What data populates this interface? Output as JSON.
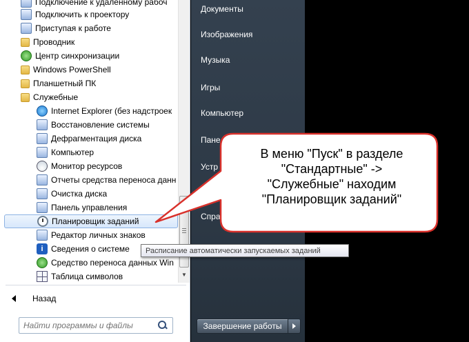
{
  "left_pane": {
    "programs": [
      {
        "label": "Подключение к удаленному рабоч",
        "icon": "remote-desktop-icon",
        "kind": "top",
        "icon_style": "generic"
      },
      {
        "label": "Подключить к проектору",
        "icon": "projector-icon",
        "kind": "top",
        "icon_style": "generic"
      },
      {
        "label": "Приступая к работе",
        "icon": "getting-started-icon",
        "kind": "top",
        "icon_style": "generic"
      },
      {
        "label": "Проводник",
        "icon": "explorer-folder-icon",
        "kind": "top",
        "icon_style": "folder"
      },
      {
        "label": "Центр синхронизации",
        "icon": "sync-center-icon",
        "kind": "top",
        "icon_style": "green"
      },
      {
        "label": "Windows PowerShell",
        "icon": "folder-icon",
        "kind": "top",
        "icon_style": "folder"
      },
      {
        "label": "Планшетный ПК",
        "icon": "folder-icon",
        "kind": "top",
        "icon_style": "folder"
      },
      {
        "label": "Служебные",
        "icon": "folder-icon",
        "kind": "top",
        "icon_style": "folder"
      },
      {
        "label": "Internet Explorer (без надстроек",
        "icon": "internet-explorer-icon",
        "kind": "sub",
        "icon_style": "ie"
      },
      {
        "label": "Восстановление системы",
        "icon": "system-restore-icon",
        "kind": "sub",
        "icon_style": "generic"
      },
      {
        "label": "Дефрагментация диска",
        "icon": "defrag-icon",
        "kind": "sub",
        "icon_style": "generic"
      },
      {
        "label": "Компьютер",
        "icon": "computer-icon",
        "kind": "sub",
        "icon_style": "generic"
      },
      {
        "label": "Монитор ресурсов",
        "icon": "resource-monitor-icon",
        "kind": "sub",
        "icon_style": "gauge"
      },
      {
        "label": "Отчеты средства переноса данн",
        "icon": "transfer-reports-icon",
        "kind": "sub",
        "icon_style": "generic"
      },
      {
        "label": "Очистка диска",
        "icon": "disk-cleanup-icon",
        "kind": "sub",
        "icon_style": "generic"
      },
      {
        "label": "Панель управления",
        "icon": "control-panel-icon",
        "kind": "sub",
        "icon_style": "generic"
      },
      {
        "label": "Планировщик заданий",
        "icon": "task-scheduler-icon",
        "kind": "sub",
        "icon_style": "clock",
        "selected": true
      },
      {
        "label": "Редактор личных знаков",
        "icon": "char-editor-icon",
        "kind": "sub",
        "icon_style": "generic"
      },
      {
        "label": "Сведения о системе",
        "icon": "system-info-icon",
        "kind": "sub",
        "icon_style": "info"
      },
      {
        "label": "Средство переноса данных Win",
        "icon": "easy-transfer-icon",
        "kind": "sub",
        "icon_style": "green"
      },
      {
        "label": "Таблица символов",
        "icon": "char-map-icon",
        "kind": "sub",
        "icon_style": "grid"
      }
    ],
    "back_label": "Назад",
    "search_placeholder": "Найти программы и файлы"
  },
  "right_pane": {
    "items": [
      "Документы",
      "Изображения",
      "Музыка",
      "Игры",
      "Компьютер",
      "Пане",
      "Устр",
      "П",
      "Спра"
    ],
    "shutdown_label": "Завершение работы"
  },
  "tooltip": "Расписание автоматически запускаемых заданий",
  "callout": {
    "lines": [
      "В меню \"Пуск\" в разделе",
      "\"Стандартные\" ->",
      "\"Служебные\" находим",
      "\"Планировщик заданий\""
    ],
    "border_color": "#d9312b"
  }
}
